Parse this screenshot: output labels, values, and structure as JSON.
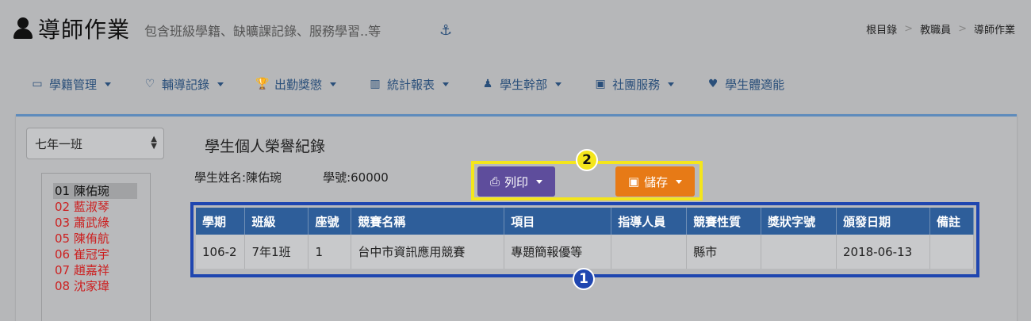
{
  "header": {
    "title": "導師作業",
    "subtitle": "包含班級學籍、缺曠課記錄、服務學習..等",
    "icon": "user-icon",
    "anchor_icon": "anchor-icon"
  },
  "breadcrumb": [
    "根目錄",
    "教職員",
    "導師作業"
  ],
  "nav": {
    "items": [
      {
        "label": "學籍管理",
        "icon": "id-card-icon",
        "dropdown": true
      },
      {
        "label": "輔導記錄",
        "icon": "heart-icon",
        "dropdown": true
      },
      {
        "label": "出勤獎懲",
        "icon": "trophy-icon",
        "dropdown": true
      },
      {
        "label": "統計報表",
        "icon": "bar-chart-icon",
        "dropdown": true
      },
      {
        "label": "學生幹部",
        "icon": "person-icon",
        "dropdown": true
      },
      {
        "label": "社團服務",
        "icon": "group-icon",
        "dropdown": true
      },
      {
        "label": "學生體適能",
        "icon": "heartbeat-icon",
        "dropdown": false
      }
    ]
  },
  "class_select": {
    "value": "七年一班"
  },
  "students": [
    {
      "label": "01 陳佑琬",
      "selected": true
    },
    {
      "label": "02 藍淑琴",
      "selected": false
    },
    {
      "label": "03 蕭武綠",
      "selected": false
    },
    {
      "label": "05 陳侑航",
      "selected": false
    },
    {
      "label": "06 崔冠宇",
      "selected": false
    },
    {
      "label": "07 趙嘉祥",
      "selected": false
    },
    {
      "label": "08 沈家瑋",
      "selected": false
    }
  ],
  "section": {
    "title": "學生個人榮譽紀錄",
    "student_name": "學生姓名:陳佑琬",
    "student_id": "學號:60000"
  },
  "buttons": {
    "print_label": "列印",
    "save_label": "儲存"
  },
  "badges": {
    "one": "1",
    "two": "2"
  },
  "colors": {
    "accent_yellow": "#f4e61c",
    "accent_blue": "#1f46b0",
    "print_button": "#5e4d9c",
    "save_button": "#e77a16",
    "table_header": "#2e5e9a",
    "student_red": "#cc1f1f"
  },
  "table": {
    "columns": [
      "學期",
      "班級",
      "座號",
      "競賽名稱",
      "項目",
      "指導人員",
      "競賽性質",
      "獎狀字號",
      "頒發日期",
      "備註"
    ],
    "rows": [
      [
        "106-2",
        "7年1班",
        "1",
        "台中市資訊應用競賽",
        "專題簡報優等",
        "",
        "縣市",
        "",
        "2018-06-13",
        ""
      ]
    ]
  }
}
